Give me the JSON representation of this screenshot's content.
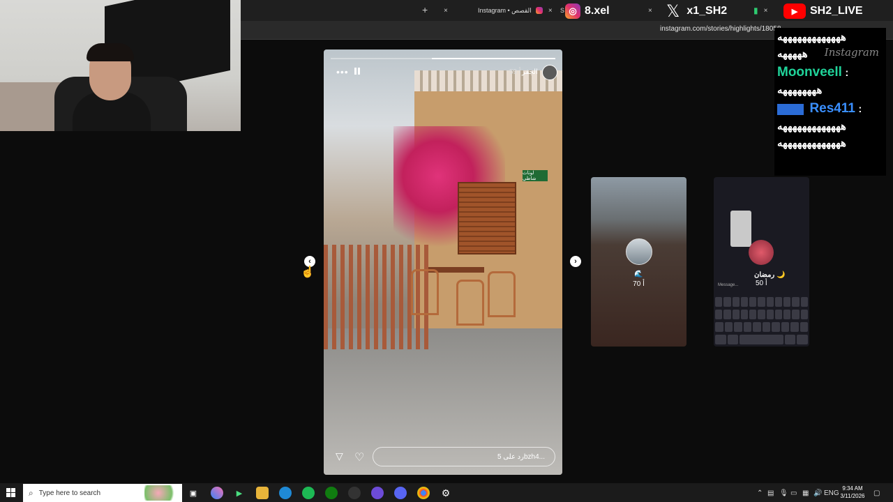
{
  "browser": {
    "new_tab_symbol": "+",
    "tabs": [
      {
        "label": "Instagram • القصص",
        "close": "×"
      },
      {
        "label": "S",
        "close": "×"
      }
    ],
    "url": "instagram.com/stories/highlights/18058"
  },
  "overlay": {
    "instagram_handle": "8.xel",
    "x_handle": "x1_SH2",
    "youtube_handle": "SH2_LIVE",
    "chat": {
      "watermark": "Instagram",
      "messages": [
        {
          "user": "",
          "text": "هههههههههههههه"
        },
        {
          "user": "",
          "text": "هههههه"
        },
        {
          "user": "Moonveell",
          "sep": ":",
          "text": "ههههههههه"
        },
        {
          "user": "Res411",
          "sep": ":",
          "text": "هههههههههههههه"
        },
        {
          "user": "",
          "text": "هههههههههههههه"
        }
      ]
    }
  },
  "story": {
    "username": "الجفر",
    "time": "59 أ",
    "more_icon": "•••",
    "reply_placeholder": "رد على 5bzh4...",
    "sign_text": "لوتاث شاطي"
  },
  "nav": {
    "prev": "‹",
    "next": "›"
  },
  "previews": [
    {
      "emoji": "🌊",
      "label": "70 أ"
    },
    {
      "title": "رمضان 🌙",
      "label": "50 أ",
      "message_hint": "Message..."
    }
  ],
  "taskbar": {
    "search_placeholder": "Type here to search",
    "language": "ENG",
    "time": "9:34 AM",
    "date": "3/11/2026"
  }
}
